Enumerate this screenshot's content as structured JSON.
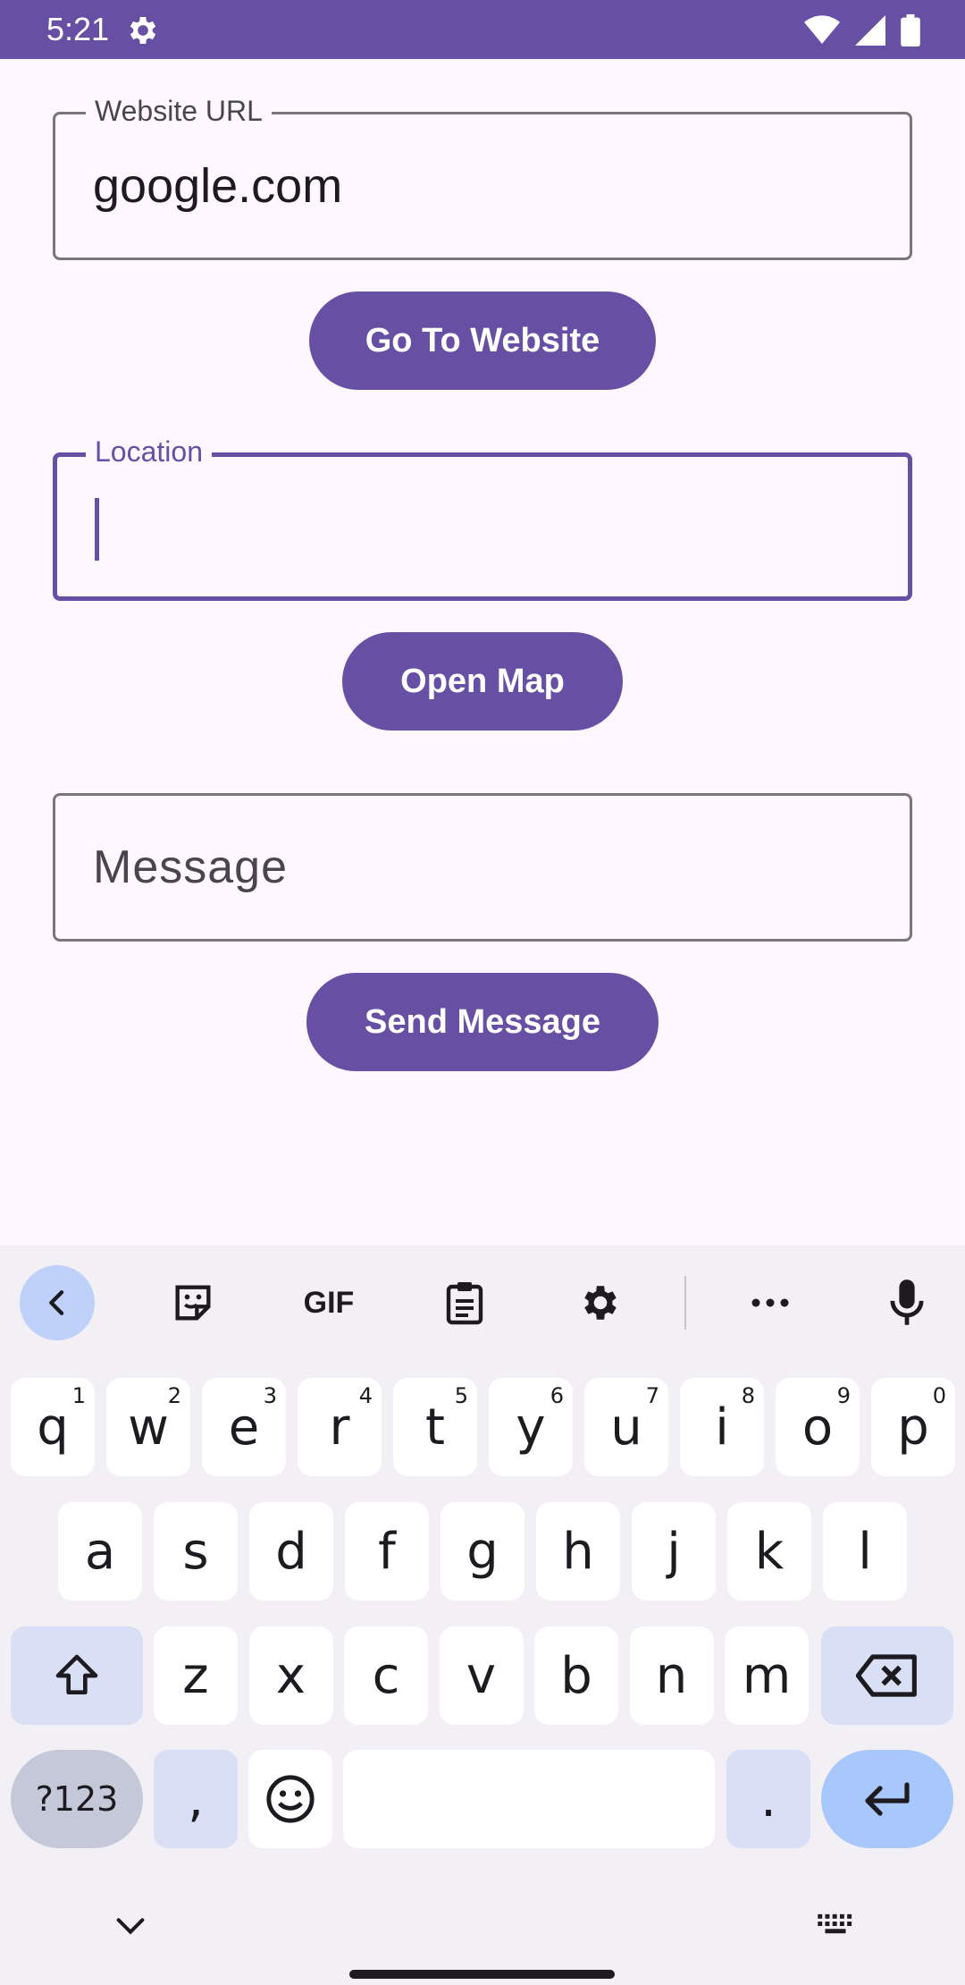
{
  "status_bar": {
    "time": "5:21",
    "icons": [
      "settings-gear-icon",
      "wifi-icon",
      "signal-icon",
      "battery-icon"
    ]
  },
  "form": {
    "website": {
      "label": "Website URL",
      "value": "google.com"
    },
    "go_button": "Go To Website",
    "location": {
      "label": "Location",
      "value": ""
    },
    "map_button": "Open Map",
    "message": {
      "placeholder": "Message",
      "value": ""
    },
    "send_button": "Send Message"
  },
  "keyboard": {
    "toolbar": [
      "back-icon",
      "sticker-icon",
      "gif-icon",
      "clipboard-icon",
      "settings-icon",
      "more-icon",
      "mic-icon"
    ],
    "gif_label": "GIF",
    "row1": [
      {
        "k": "q",
        "h": "1"
      },
      {
        "k": "w",
        "h": "2"
      },
      {
        "k": "e",
        "h": "3"
      },
      {
        "k": "r",
        "h": "4"
      },
      {
        "k": "t",
        "h": "5"
      },
      {
        "k": "y",
        "h": "6"
      },
      {
        "k": "u",
        "h": "7"
      },
      {
        "k": "i",
        "h": "8"
      },
      {
        "k": "o",
        "h": "9"
      },
      {
        "k": "p",
        "h": "0"
      }
    ],
    "row2": [
      "a",
      "s",
      "d",
      "f",
      "g",
      "h",
      "j",
      "k",
      "l"
    ],
    "row3": [
      "z",
      "x",
      "c",
      "v",
      "b",
      "n",
      "m"
    ],
    "sym_label": "?123",
    "comma": ",",
    "period": ".",
    "colors": {
      "accent": "#6750A4",
      "key": "#FFFFFF",
      "mod_key": "#D9E0F5",
      "enter": "#A8C7FA",
      "background": "#F2EFF5"
    }
  }
}
